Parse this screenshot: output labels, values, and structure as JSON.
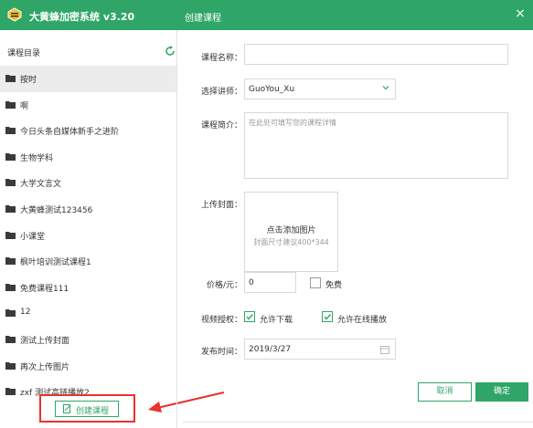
{
  "app": {
    "title": "大黄蜂加密系统 v3.20"
  },
  "dialog": {
    "title": "创建课程",
    "close": "×"
  },
  "sidebar": {
    "header": "课程目录",
    "items": [
      {
        "label": "按时",
        "selected": true
      },
      {
        "label": "啊"
      },
      {
        "label": "今日头条自媒体新手之进阶"
      },
      {
        "label": "生物学科"
      },
      {
        "label": "大学文言文"
      },
      {
        "label": "大黄蜂测试123456"
      },
      {
        "label": "小课堂"
      },
      {
        "label": "枫叶培训测试课程1"
      },
      {
        "label": "免费课程111"
      },
      {
        "label": "12"
      },
      {
        "label": "测试上传封面"
      },
      {
        "label": "再次上传图片"
      },
      {
        "label": "zxf 测试高链播放2"
      }
    ],
    "create_button": "创建课程"
  },
  "form": {
    "course_name_label": "课程名称：",
    "course_name_value": "",
    "teacher_label": "选择讲师：",
    "teacher_value": "GuoYou_Xu",
    "intro_label": "课程简介：",
    "intro_placeholder": "在此处可填写您的课程详情",
    "cover_label": "上传封面：",
    "cover_add": "点击添加图片",
    "cover_hint": "封面尺寸建议400*344",
    "price_label": "价格/元：",
    "price_value": "0",
    "free_label": "免费",
    "free_checked": false,
    "auth_label": "视频授权：",
    "allow_download_label": "允许下载",
    "allow_download_checked": true,
    "allow_online_label": "允许在线播放",
    "allow_online_checked": true,
    "publish_label": "发布时间：",
    "publish_value": "2019/3/27"
  },
  "buttons": {
    "cancel": "取消",
    "confirm": "确定"
  },
  "colors": {
    "brand": "#2fa667",
    "annotation": "#e8322e",
    "folder": "#3a3a3a"
  }
}
